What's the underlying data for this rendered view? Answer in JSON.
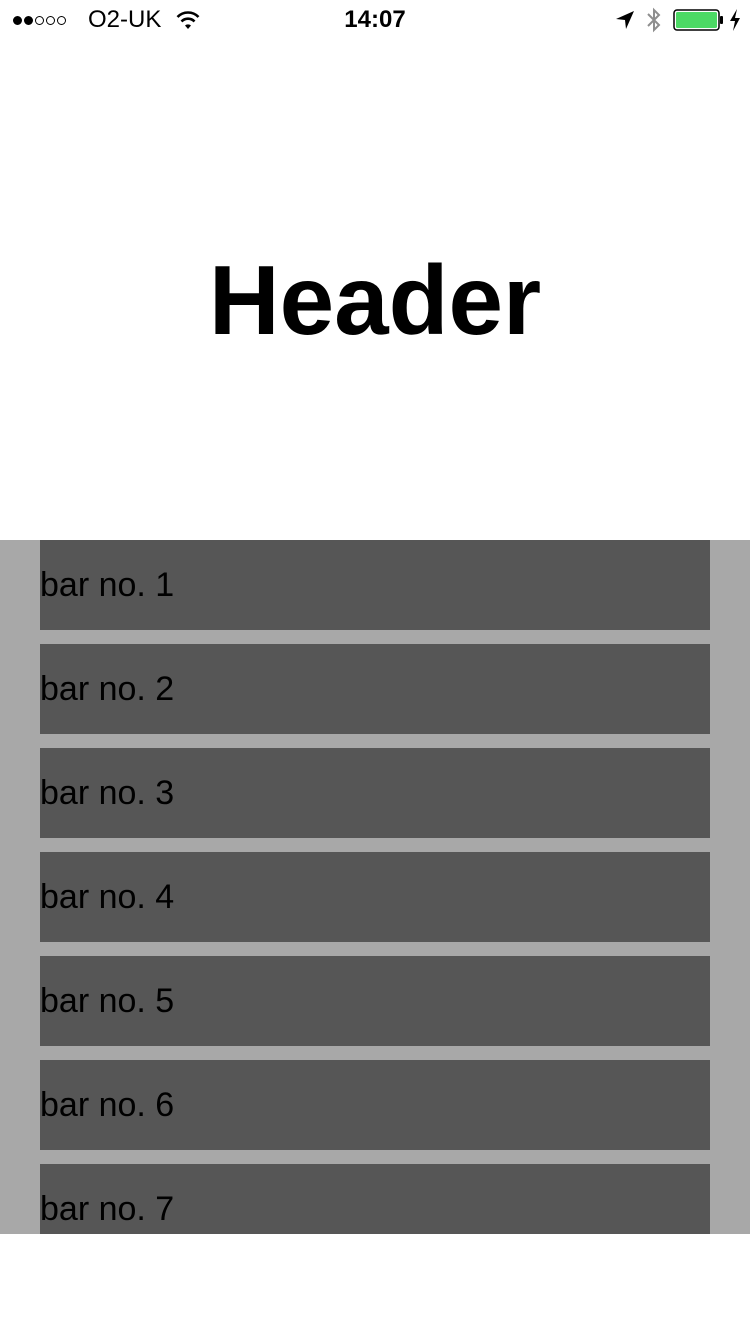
{
  "status_bar": {
    "carrier": "O2-UK",
    "time": "14:07",
    "signal_strength": 2,
    "signal_max": 5,
    "battery_color": "#4cd964",
    "battery_level": 1.0,
    "icons": [
      "wifi-icon",
      "location-arrow-icon",
      "bluetooth-icon",
      "battery-icon",
      "charging-bolt-icon"
    ]
  },
  "header": {
    "title": "Header"
  },
  "list": {
    "background_color": "#a8a8a8",
    "bar_color": "#565656",
    "items": [
      {
        "label": "bar no. 1"
      },
      {
        "label": "bar no. 2"
      },
      {
        "label": "bar no. 3"
      },
      {
        "label": "bar no. 4"
      },
      {
        "label": "bar no. 5"
      },
      {
        "label": "bar no. 6"
      },
      {
        "label": "bar no. 7"
      }
    ]
  }
}
